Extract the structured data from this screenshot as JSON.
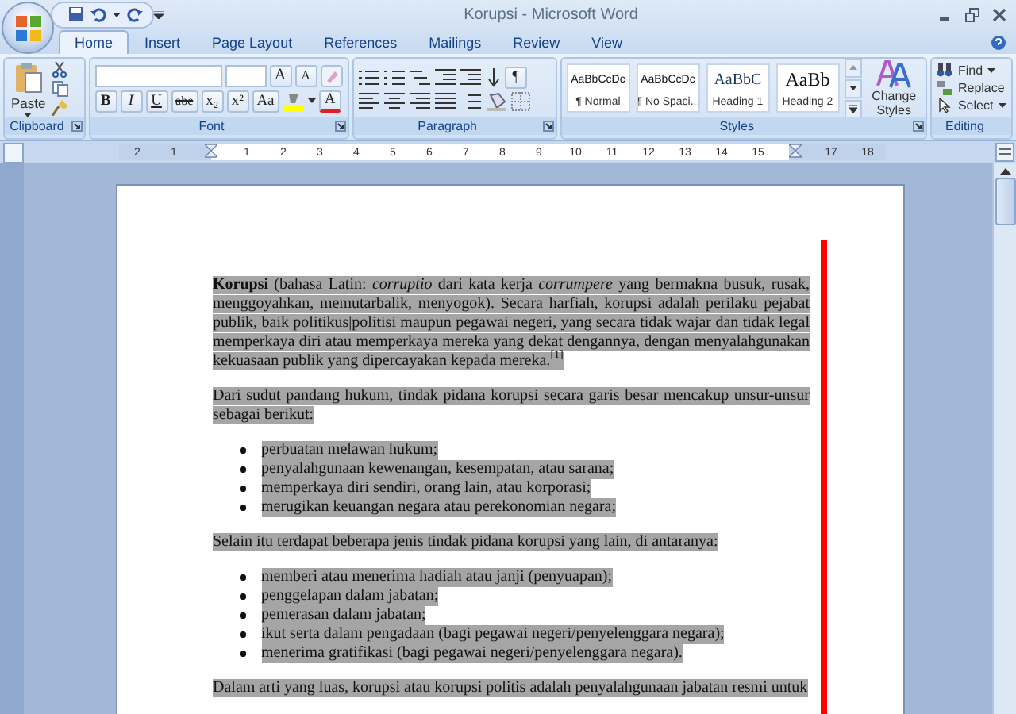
{
  "window": {
    "title": "Korupsi - Microsoft Word"
  },
  "tabs": [
    {
      "label": "Home",
      "selected": true
    },
    {
      "label": "Insert",
      "selected": false
    },
    {
      "label": "Page Layout",
      "selected": false
    },
    {
      "label": "References",
      "selected": false
    },
    {
      "label": "Mailings",
      "selected": false
    },
    {
      "label": "Review",
      "selected": false
    },
    {
      "label": "View",
      "selected": false
    }
  ],
  "ribbon": {
    "clipboard": {
      "label": "Clipboard",
      "paste": "Paste"
    },
    "font": {
      "label": "Font",
      "grow": "A",
      "shrink": "A",
      "format_buttons": [
        "B",
        "I",
        "U",
        "abe",
        "x₂",
        "x²",
        "Aa"
      ],
      "font_color": "A"
    },
    "paragraph": {
      "label": "Paragraph",
      "pilcrow": "¶"
    },
    "styles": {
      "label": "Styles",
      "items": [
        {
          "preview": "AaBbCcDc",
          "name": "¶ Normal",
          "kind": "body"
        },
        {
          "preview": "AaBbCcDc",
          "name": "¶ No Spaci...",
          "kind": "body"
        },
        {
          "preview": "AaBbC",
          "name": "Heading 1",
          "kind": "heading1"
        },
        {
          "preview": "AaBb",
          "name": "Heading 2",
          "kind": "heading2"
        }
      ],
      "change_styles": "Change Styles"
    },
    "editing": {
      "label": "Editing",
      "find": "Find",
      "replace": "Replace",
      "select": "Select"
    }
  },
  "ruler": [
    {
      "kind": "number",
      "label": "2"
    },
    {
      "kind": "number",
      "label": "1"
    },
    {
      "kind": "indent"
    },
    {
      "kind": "number",
      "label": "1"
    },
    {
      "kind": "number",
      "label": "2"
    },
    {
      "kind": "number",
      "label": "3"
    },
    {
      "kind": "number",
      "label": "4"
    },
    {
      "kind": "number",
      "label": "5"
    },
    {
      "kind": "number",
      "label": "6"
    },
    {
      "kind": "number",
      "label": "7"
    },
    {
      "kind": "number",
      "label": "8"
    },
    {
      "kind": "number",
      "label": "9"
    },
    {
      "kind": "number",
      "label": "10"
    },
    {
      "kind": "number",
      "label": "11"
    },
    {
      "kind": "number",
      "label": "12"
    },
    {
      "kind": "number",
      "label": "13"
    },
    {
      "kind": "number",
      "label": "14"
    },
    {
      "kind": "number",
      "label": "15"
    },
    {
      "kind": "indent"
    },
    {
      "kind": "number",
      "label": "17"
    },
    {
      "kind": "number",
      "label": "18"
    }
  ],
  "document": {
    "blocks": [
      {
        "kind": "paragraph",
        "selected": true,
        "text": "**Korupsi** (bahasa Latin: *corruptio* dari kata kerja *corrumpere* yang bermakna busuk, rusak, menggoyahkan, memutarbalik, menyogok). Secara harfiah, korupsi adalah perilaku pejabat publik, baik politikus|politisi maupun pegawai negeri, yang secara tidak wajar dan tidak legal memperkaya diri atau memperkaya mereka yang dekat dengannya, dengan menyalahgunakan kekuasaan publik yang dipercayakan kepada mereka.$^{[1]}$"
      },
      {
        "kind": "paragraph",
        "selected": true,
        "text": "Dari sudut pandang hukum, tindak pidana korupsi secara garis besar mencakup unsur-unsur sebagai berikut:"
      },
      {
        "kind": "bullets",
        "selected": true,
        "items": [
          "perbuatan melawan hukum;",
          "penyalahgunaan kewenangan, kesempatan, atau sarana;",
          "memperkaya diri sendiri, orang lain, atau korporasi;",
          "merugikan keuangan negara atau perekonomian negara;"
        ]
      },
      {
        "kind": "paragraph",
        "selected": true,
        "text": "Selain itu terdapat beberapa jenis tindak pidana korupsi yang lain, di antaranya:"
      },
      {
        "kind": "bullets",
        "selected": true,
        "items": [
          "memberi atau menerima hadiah atau janji (penyuapan);",
          "penggelapan dalam jabatan;",
          "pemerasan dalam jabatan;",
          "ikut serta dalam pengadaan (bagi pegawai negeri/penyelenggara negara);",
          "menerima gratifikasi (bagi pegawai negeri/penyelenggara negara)."
        ]
      },
      {
        "kind": "paragraph",
        "selected": true,
        "text": "Dalam arti yang luas, korupsi atau korupsi politis adalah penyalahgunaan jabatan resmi untuk"
      }
    ]
  }
}
